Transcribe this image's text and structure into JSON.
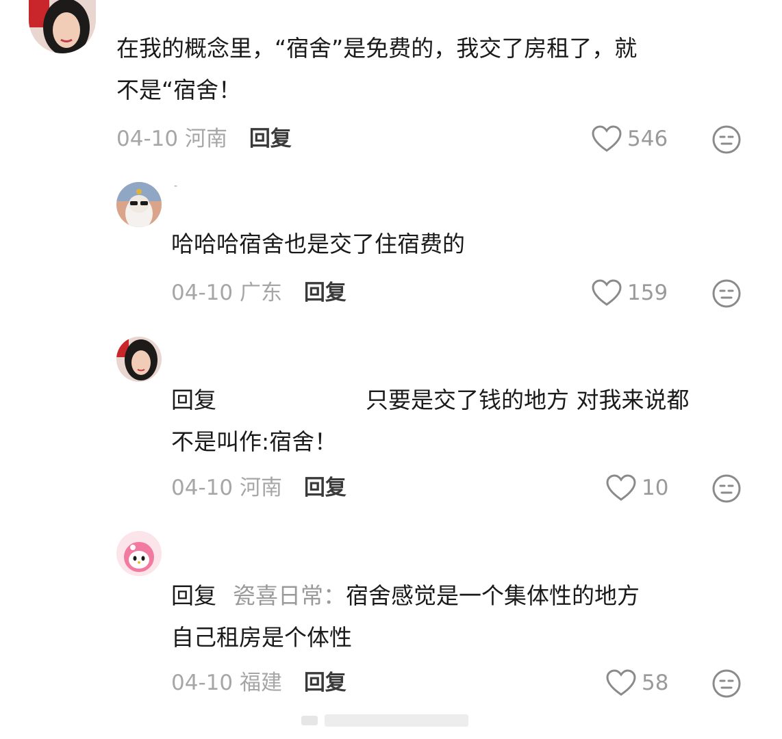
{
  "comments": [
    {
      "username": "",
      "line1": "在我的概念里，“宿舍”是免费的，我交了房租了，就",
      "line2": "不是“宿舍！",
      "date": "04-10",
      "location": "河南",
      "reply_label": "回复",
      "likes": "546",
      "avatar_icon": "woman-avatar"
    },
    {
      "username": "-",
      "line1": "哈哈哈宿舍也是交了住宿费的",
      "line2": "",
      "date": "04-10",
      "location": "广东",
      "reply_label": "回复",
      "likes": "159",
      "avatar_icon": "cat-with-sunglasses-avatar"
    },
    {
      "username": "",
      "reply_prefix": "回复",
      "mention": "",
      "line1": "只要是交了钱的地方 对我来说都",
      "line2": "不是叫作:宿舍！",
      "date": "04-10",
      "location": "河南",
      "reply_label": "回复",
      "likes": "10",
      "avatar_icon": "woman-avatar"
    },
    {
      "username": "",
      "reply_prefix": "回复",
      "mention": "瓷喜日常：",
      "line1": "宿舍感觉是一个集体性的地方",
      "line2": "自己租房是个体性",
      "date": "04-10",
      "location": "福建",
      "reply_label": "回复",
      "likes": "58",
      "avatar_icon": "pink-cartoon-avatar"
    }
  ],
  "colors": {
    "meta": "#a6a6a6",
    "text": "#1a1a1a",
    "mention": "#9a9a9a",
    "icon": "#8a8a8a"
  }
}
